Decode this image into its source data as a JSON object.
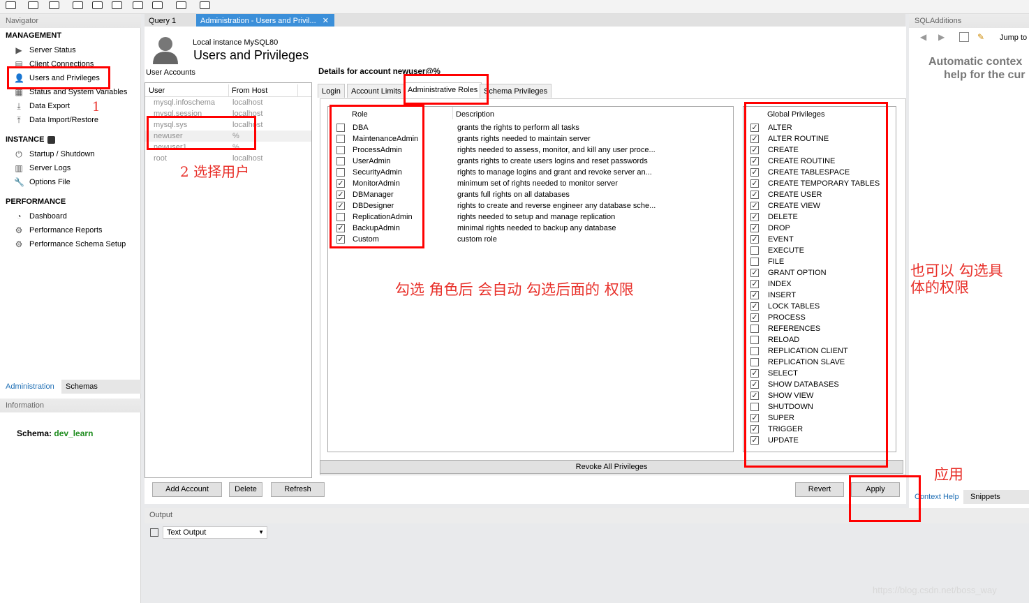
{
  "toolbar": {
    "icons": [
      "new-connection-icon",
      "open-sql-icon",
      "info-icon",
      "db-icon",
      "table-icon",
      "view-icon",
      "procedure-icon",
      "function-icon",
      "search-icon",
      "reconnect-icon"
    ]
  },
  "navigator": {
    "title": "Navigator",
    "management": {
      "title": "MANAGEMENT",
      "items": [
        "Server Status",
        "Client Connections",
        "Users and Privileges",
        "Status and System Variables",
        "Data Export",
        "Data Import/Restore"
      ]
    },
    "instance": {
      "title": "INSTANCE",
      "items": [
        "Startup / Shutdown",
        "Server Logs",
        "Options File"
      ]
    },
    "performance": {
      "title": "PERFORMANCE",
      "items": [
        "Dashboard",
        "Performance Reports",
        "Performance Schema Setup"
      ]
    },
    "bottom_tabs": [
      "Administration",
      "Schemas"
    ],
    "information_title": "Information",
    "schema_label": "Schema:",
    "schema_value": "dev_learn"
  },
  "main_tabs": [
    "Query 1",
    "Administration - Users and Privil..."
  ],
  "header": {
    "instance": "Local instance MySQL80",
    "title": "Users and Privileges"
  },
  "accounts": {
    "label": "User Accounts",
    "columns": [
      "User",
      "From Host"
    ],
    "rows": [
      {
        "user": "mysql.infoschema",
        "host": "localhost"
      },
      {
        "user": "mysql.session",
        "host": "localhost"
      },
      {
        "user": "mysql.sys",
        "host": "localhost"
      },
      {
        "user": "newuser",
        "host": "%"
      },
      {
        "user": "newuser1",
        "host": "%"
      },
      {
        "user": "root",
        "host": "localhost"
      }
    ]
  },
  "details": {
    "title": "Details for account newuser@%",
    "tabs": [
      "Login",
      "Account Limits",
      "Administrative Roles",
      "Schema Privileges"
    ],
    "roles_columns": [
      "Role",
      "Description"
    ],
    "roles": [
      {
        "name": "DBA",
        "desc": "grants the rights to perform all tasks",
        "checked": false
      },
      {
        "name": "MaintenanceAdmin",
        "desc": "grants rights needed to maintain server",
        "checked": false
      },
      {
        "name": "ProcessAdmin",
        "desc": "rights needed to assess, monitor, and kill any user proce...",
        "checked": false
      },
      {
        "name": "UserAdmin",
        "desc": "grants rights to create users logins and reset passwords",
        "checked": false
      },
      {
        "name": "SecurityAdmin",
        "desc": "rights to manage logins and grant and revoke server an...",
        "checked": false
      },
      {
        "name": "MonitorAdmin",
        "desc": "minimum set of rights needed to monitor server",
        "checked": true
      },
      {
        "name": "DBManager",
        "desc": "grants full rights on all databases",
        "checked": true
      },
      {
        "name": "DBDesigner",
        "desc": "rights to create and reverse engineer any database sche...",
        "checked": true
      },
      {
        "name": "ReplicationAdmin",
        "desc": "rights needed to setup and manage replication",
        "checked": false
      },
      {
        "name": "BackupAdmin",
        "desc": "minimal rights needed to backup any database",
        "checked": true
      },
      {
        "name": "Custom",
        "desc": "custom role",
        "checked": true
      }
    ],
    "global_title": "Global Privileges",
    "privileges": [
      {
        "name": "ALTER",
        "checked": true
      },
      {
        "name": "ALTER ROUTINE",
        "checked": true
      },
      {
        "name": "CREATE",
        "checked": true
      },
      {
        "name": "CREATE ROUTINE",
        "checked": true
      },
      {
        "name": "CREATE TABLESPACE",
        "checked": true
      },
      {
        "name": "CREATE TEMPORARY TABLES",
        "checked": true
      },
      {
        "name": "CREATE USER",
        "checked": true
      },
      {
        "name": "CREATE VIEW",
        "checked": true
      },
      {
        "name": "DELETE",
        "checked": true
      },
      {
        "name": "DROP",
        "checked": true
      },
      {
        "name": "EVENT",
        "checked": true
      },
      {
        "name": "EXECUTE",
        "checked": false
      },
      {
        "name": "FILE",
        "checked": false
      },
      {
        "name": "GRANT OPTION",
        "checked": true
      },
      {
        "name": "INDEX",
        "checked": true
      },
      {
        "name": "INSERT",
        "checked": true
      },
      {
        "name": "LOCK TABLES",
        "checked": true
      },
      {
        "name": "PROCESS",
        "checked": true
      },
      {
        "name": "REFERENCES",
        "checked": false
      },
      {
        "name": "RELOAD",
        "checked": false
      },
      {
        "name": "REPLICATION CLIENT",
        "checked": false
      },
      {
        "name": "REPLICATION SLAVE",
        "checked": false
      },
      {
        "name": "SELECT",
        "checked": true
      },
      {
        "name": "SHOW DATABASES",
        "checked": true
      },
      {
        "name": "SHOW VIEW",
        "checked": true
      },
      {
        "name": "SHUTDOWN",
        "checked": false
      },
      {
        "name": "SUPER",
        "checked": true
      },
      {
        "name": "TRIGGER",
        "checked": true
      },
      {
        "name": "UPDATE",
        "checked": true
      }
    ],
    "revoke_label": "Revoke All Privileges"
  },
  "buttons": {
    "add": "Add Account",
    "delete": "Delete",
    "refresh": "Refresh",
    "revert": "Revert",
    "apply": "Apply"
  },
  "sqladditions": {
    "title": "SQLAdditions",
    "jump": "Jump to",
    "help_line1": "Automatic contex",
    "help_line2": "help for the cur",
    "tabs": [
      "Context Help",
      "Snippets"
    ]
  },
  "output": {
    "title": "Output",
    "selector": "Text Output"
  },
  "annotations": {
    "a1": "1",
    "a2": "2 选择用户",
    "roles_note": "勾选 角色后 会自动 勾选后面的 权限",
    "priv_note_1": "也可以 勾选具",
    "priv_note_2": "体的权限",
    "apply_note": "应用"
  },
  "watermark": "https://blog.csdn.net/boss_way"
}
